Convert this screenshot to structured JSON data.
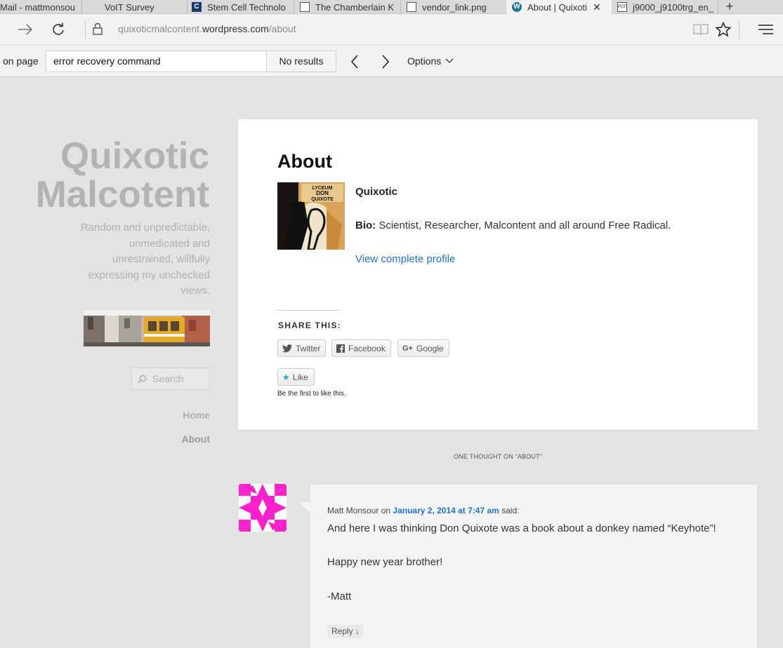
{
  "browser": {
    "tabs": [
      {
        "title": "Mail - mattmonsou",
        "icon": "mail-icon"
      },
      {
        "title": "VoIT Survey",
        "icon": "document-icon"
      },
      {
        "title": "Stem Cell Technolo",
        "icon": "stemcell-favicon"
      },
      {
        "title": "The Chamberlain K",
        "icon": "document-icon"
      },
      {
        "title": "vendor_link.png",
        "icon": "image-icon"
      },
      {
        "title": "About | Quixoti",
        "icon": "wordpress-icon"
      },
      {
        "title": "j9000_j9100trg_en_",
        "icon": "pdf-icon"
      }
    ],
    "address": {
      "prefix": "quixoticmalcontent.",
      "domain": "wordpress.com",
      "path": "/about"
    },
    "find": {
      "label": "on page",
      "query": "error recovery command",
      "results": "No results",
      "options_label": "Options"
    }
  },
  "site": {
    "title_line1": "Quixotic",
    "title_line2": "Malcotent",
    "description": "Random and unpredictable, unmedicated and unrestrained, willfully expressing my unchecked views.",
    "search_placeholder": "Search",
    "nav": [
      {
        "label": "Home"
      },
      {
        "label": "About"
      }
    ]
  },
  "post": {
    "title": "About",
    "author_name": "Quixotic",
    "bio_label": "Bio:",
    "bio_text": "Scientist, Researcher, Malcontent and all around Free Radical.",
    "profile_link": "View complete profile",
    "share_title": "SHARE THIS:",
    "share_buttons": [
      {
        "label": "Twitter"
      },
      {
        "label": "Facebook"
      },
      {
        "label": "Google"
      }
    ],
    "like_label": "Like",
    "like_note": "Be the first to like this."
  },
  "comments": {
    "title": "ONE THOUGHT ON “ABOUT”",
    "items": [
      {
        "author": "Matt Monsour",
        "on_word": "on",
        "date": "January 2, 2014 at 7:47 am",
        "said": "said:",
        "paragraphs": [
          "And here I was thinking Don Quixote was a book about a donkey named “Keyhote”!",
          "Happy new year brother!",
          "-Matt"
        ],
        "reply_label": "Reply ↓"
      }
    ]
  },
  "colors": {
    "link": "#2173c6",
    "site_title": "#b3b3b3",
    "avatar_magenta": "#ff22cc"
  }
}
